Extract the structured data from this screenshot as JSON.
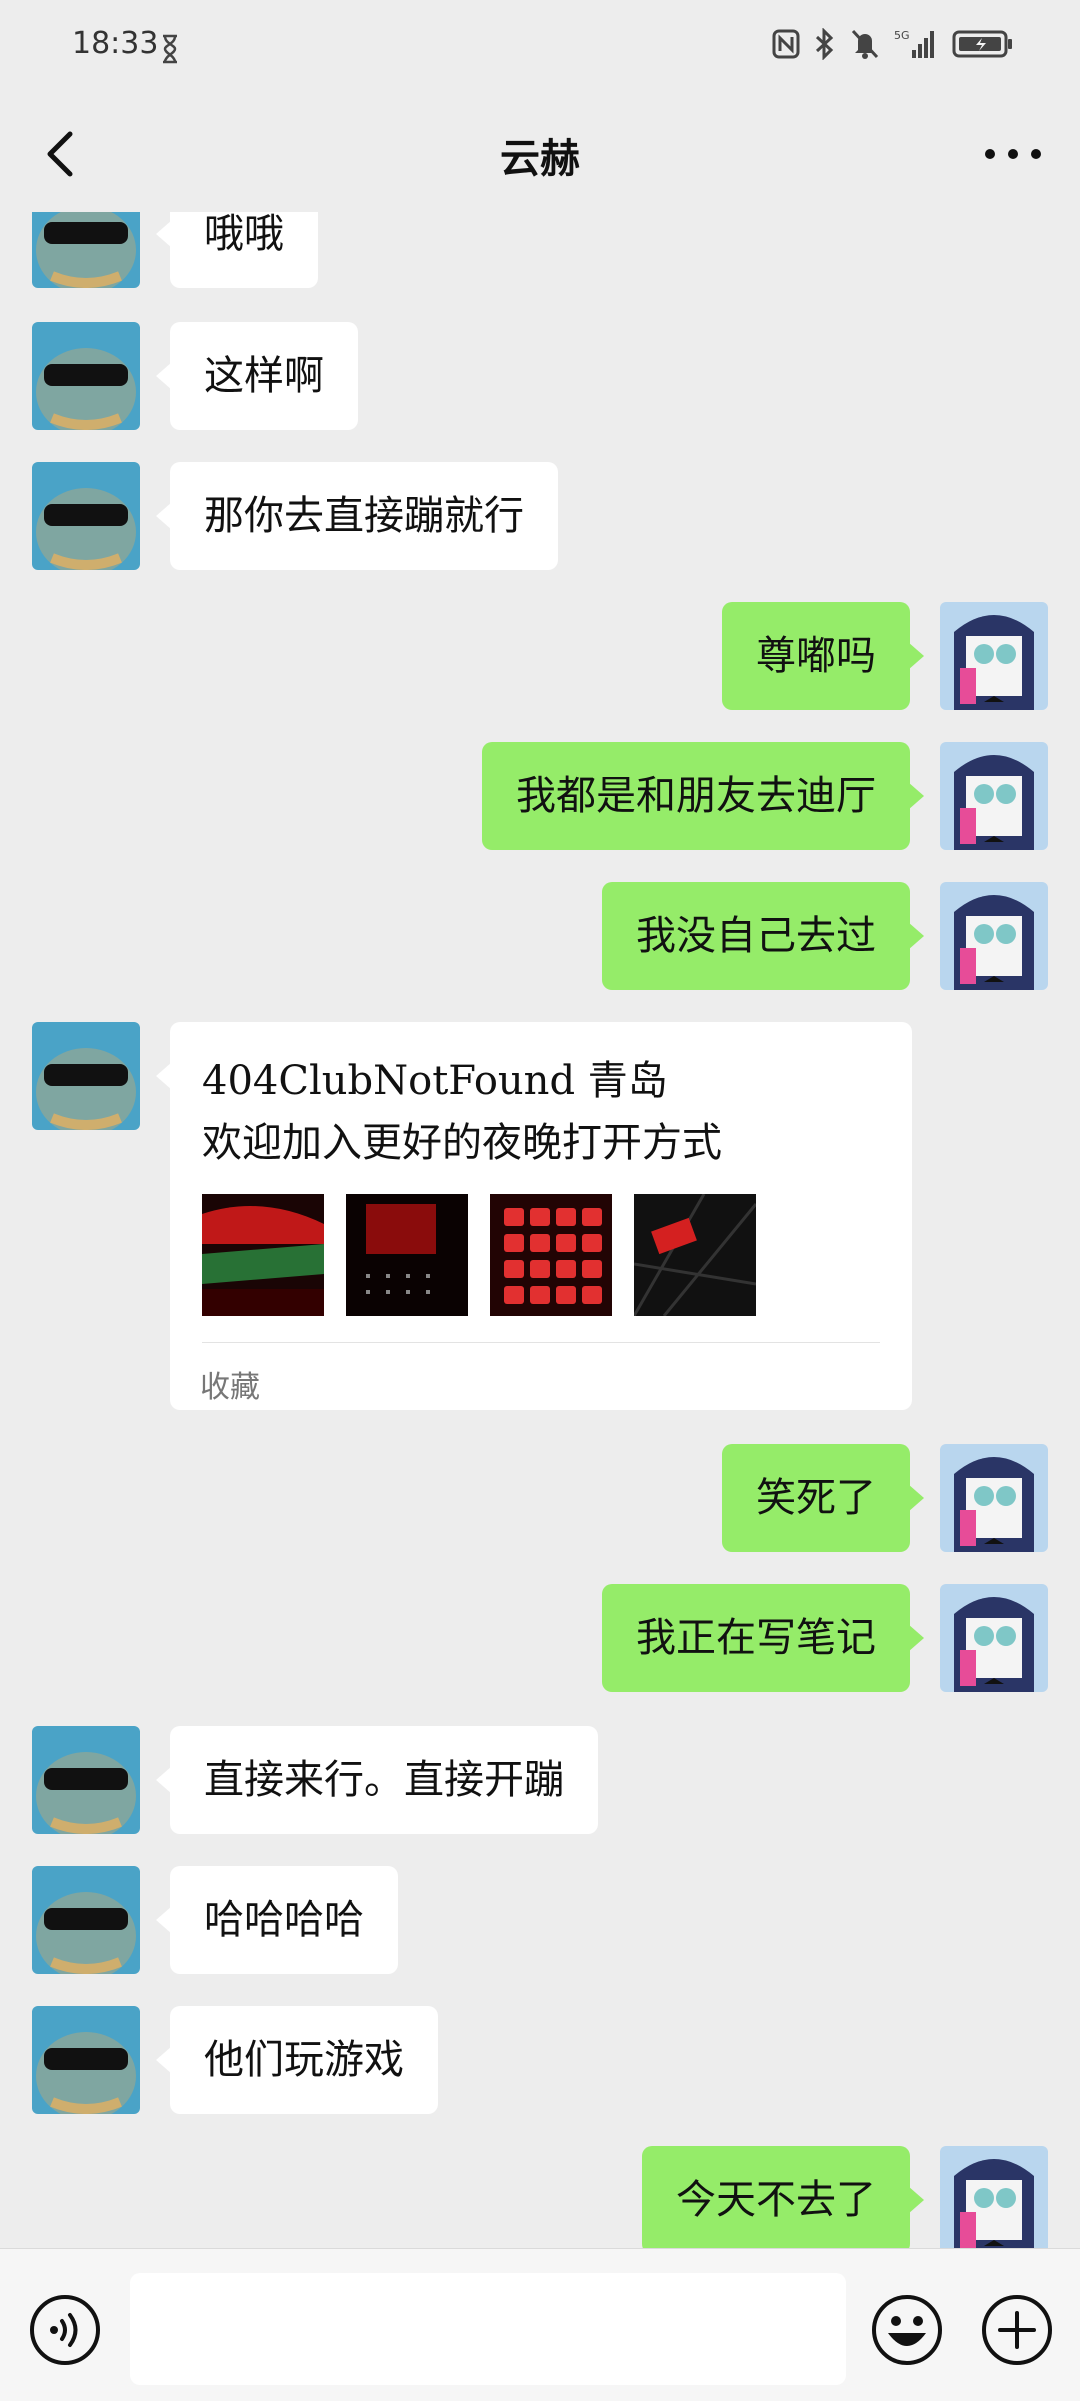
{
  "status": {
    "time": "18:33",
    "network": "5G"
  },
  "header": {
    "title": "云赫"
  },
  "messages": [
    {
      "text": "哦哦"
    },
    {
      "text": "这样啊"
    },
    {
      "text": "那你去直接蹦就行"
    },
    {
      "text": "尊嘟吗"
    },
    {
      "text": "我都是和朋友去迪厅"
    },
    {
      "text": "我没自己去过"
    },
    {
      "line1": "404ClubNotFound 青岛",
      "line2": "欢迎加入更好的夜晚打开方式",
      "source": "收藏"
    },
    {
      "text": "笑死了"
    },
    {
      "text": "我正在写笔记"
    },
    {
      "text": "直接来行。直接开蹦"
    },
    {
      "text": "哈哈哈哈"
    },
    {
      "text": "他们玩游戏"
    },
    {
      "text": "今天不去了"
    }
  ],
  "colors": {
    "background": "#ededed",
    "self_bubble": "#95ec69",
    "other_bubble": "#ffffff"
  }
}
